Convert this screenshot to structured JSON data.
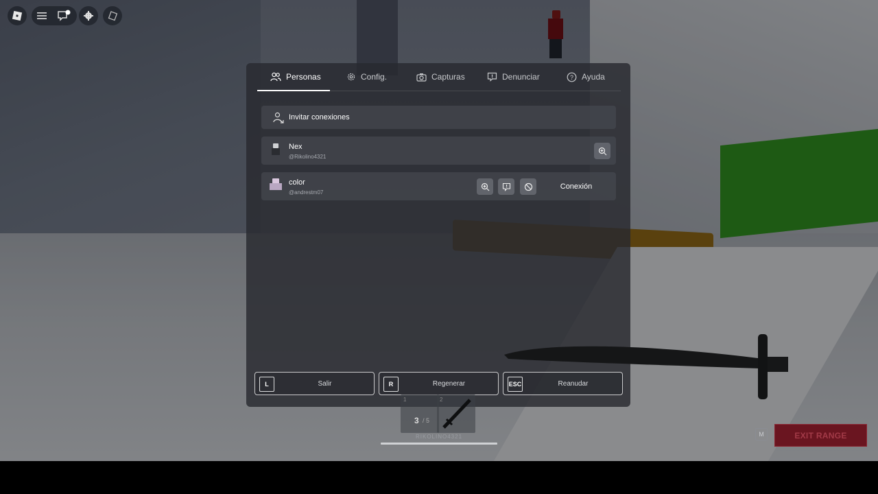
{
  "topbar": {
    "icons": [
      "roblox-logo-icon",
      "menu-icon",
      "chat-icon",
      "settings-icon",
      "backpack-icon"
    ]
  },
  "tabs": [
    {
      "label": "Personas",
      "icon": "people-icon",
      "active": true
    },
    {
      "label": "Config.",
      "icon": "gear-icon",
      "active": false
    },
    {
      "label": "Capturas",
      "icon": "camera-icon",
      "active": false
    },
    {
      "label": "Denunciar",
      "icon": "report-icon",
      "active": false
    },
    {
      "label": "Ayuda",
      "icon": "help-icon",
      "active": false
    }
  ],
  "invite": {
    "label": "Invitar conexiones"
  },
  "players": [
    {
      "name": "Nex",
      "handle": "@Rikolino4321"
    },
    {
      "name": "color",
      "handle": "@andrestm07",
      "action": "Conexión"
    }
  ],
  "actions": [
    {
      "key": "L",
      "label": "Salir"
    },
    {
      "key": "R",
      "label": "Regenerar"
    },
    {
      "key": "ESC",
      "label": "Reanudar"
    }
  ],
  "hotbar": {
    "ammo": "3",
    "ammo_max": "/ 5",
    "slot1_number": "1",
    "slot2_number": "2",
    "username": "RIKOLINO4321"
  },
  "exit_range": {
    "key": "M",
    "label": "EXIT RANGE",
    "color": "#6a1520"
  }
}
